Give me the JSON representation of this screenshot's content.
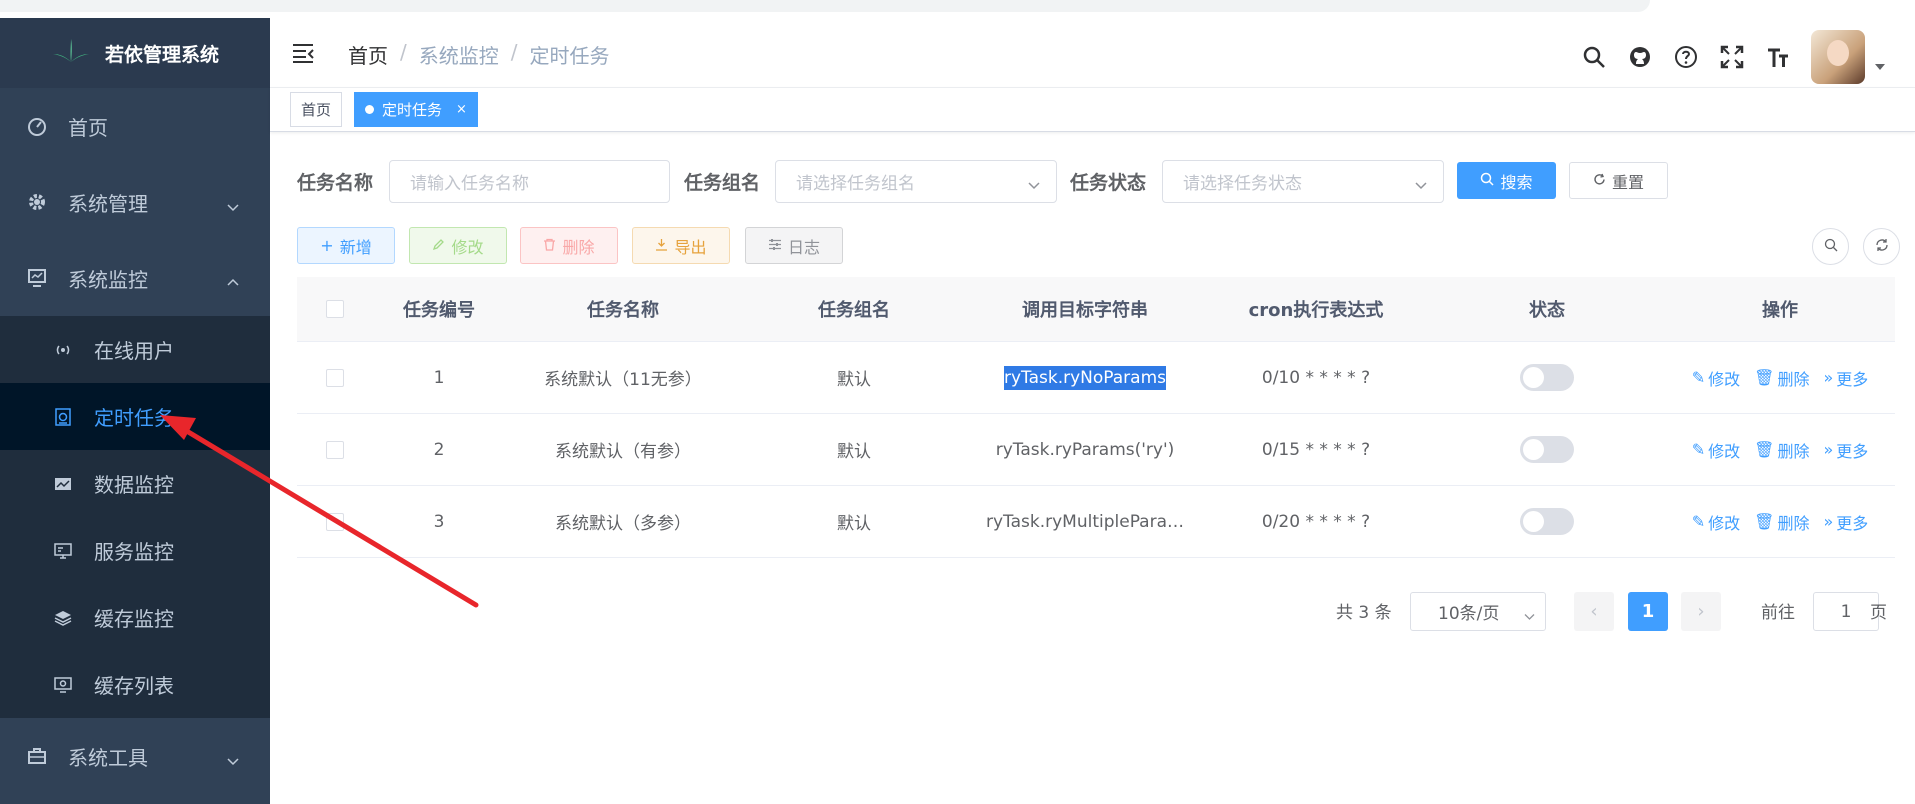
{
  "app": {
    "title": "若依管理系统"
  },
  "sidebar": {
    "items": [
      {
        "label": "首页"
      },
      {
        "label": "系统管理"
      },
      {
        "label": "系统监控"
      },
      {
        "label": "系统工具"
      }
    ],
    "monitor_sub": [
      {
        "label": "在线用户"
      },
      {
        "label": "定时任务"
      },
      {
        "label": "数据监控"
      },
      {
        "label": "服务监控"
      },
      {
        "label": "缓存监控"
      },
      {
        "label": "缓存列表"
      }
    ]
  },
  "breadcrumb": [
    "首页",
    "系统监控",
    "定时任务"
  ],
  "tags": {
    "home": "首页",
    "active": "定时任务",
    "close": "×"
  },
  "search": {
    "job_name_label": "任务名称",
    "job_name_placeholder": "请输入任务名称",
    "job_group_label": "任务组名",
    "job_group_placeholder": "请选择任务组名",
    "status_label": "任务状态",
    "status_placeholder": "请选择任务状态",
    "search_button": "搜索",
    "reset_button": "重置"
  },
  "toolbar": {
    "add": "新增",
    "edit": "修改",
    "delete": "删除",
    "export": "导出",
    "log": "日志"
  },
  "table": {
    "headers": [
      "任务编号",
      "任务名称",
      "任务组名",
      "调用目标字符串",
      "cron执行表达式",
      "状态",
      "操作"
    ],
    "rows": [
      {
        "id": "1",
        "name": "系统默认（11无参）",
        "group": "默认",
        "target": "ryTask.ryNoParams",
        "cron": "0/10 * * * * ?",
        "enabled": false
      },
      {
        "id": "2",
        "name": "系统默认（有参）",
        "group": "默认",
        "target": "ryTask.ryParams('ry')",
        "cron": "0/15 * * * * ?",
        "enabled": false
      },
      {
        "id": "3",
        "name": "系统默认（多参）",
        "group": "默认",
        "target": "ryTask.ryMultiplePara…",
        "cron": "0/20 * * * * ?",
        "enabled": false
      }
    ],
    "ops": {
      "edit": "修改",
      "delete": "删除",
      "more": "更多"
    }
  },
  "pagination": {
    "total": "共 3 条",
    "page_size": "10条/页",
    "current": "1",
    "goto_label": "前往",
    "goto_value": "1",
    "unit": "页"
  },
  "colors": {
    "sidebar_bg": "#304156",
    "active_menu": "#409eff",
    "primary": "#409eff",
    "annotation_arrow": "#e8262b"
  }
}
